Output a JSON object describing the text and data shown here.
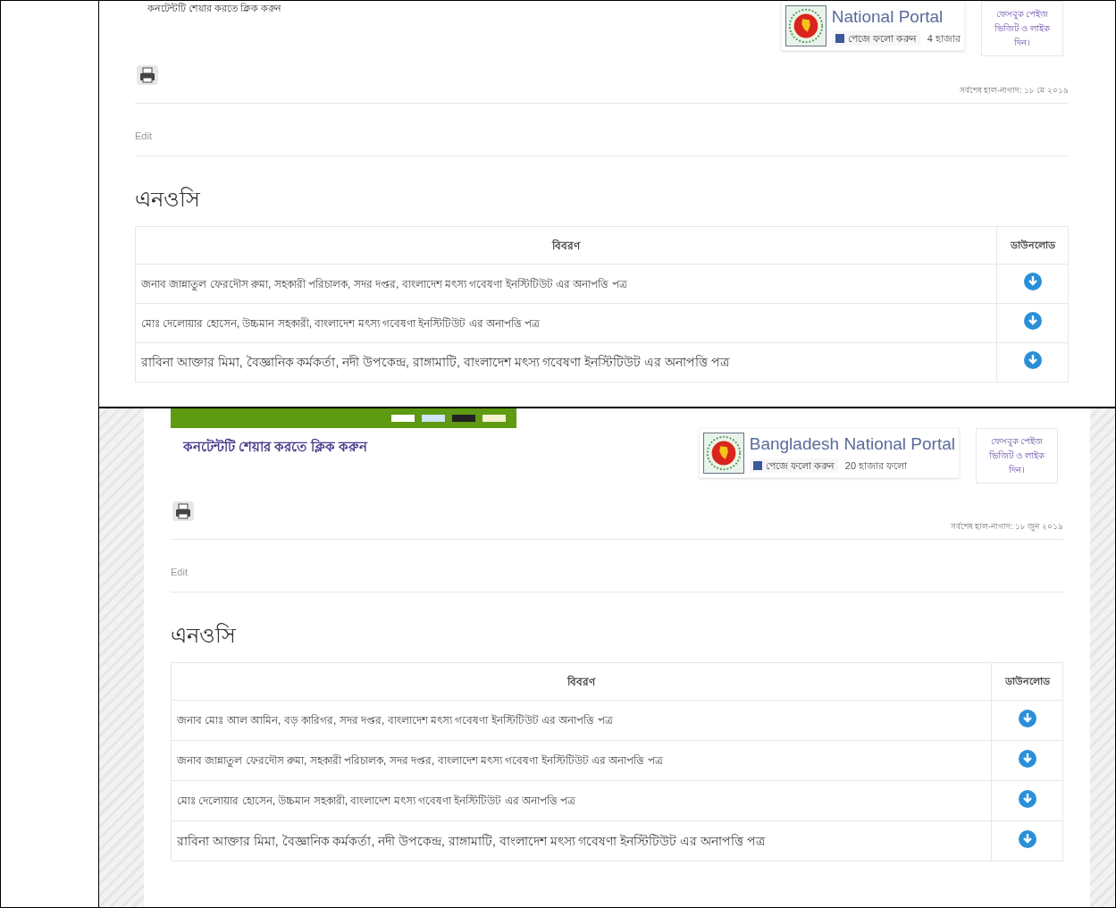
{
  "screenshots": [
    {
      "kind": "cropped",
      "share_link": "কনটেন্টটি শেয়ার করতে ক্লিক করুন",
      "portal": {
        "title": "National Portal",
        "follow": "পেজে ফলো করুন",
        "count": "4 হাজার"
      },
      "side_note": "ফেসবুক পেইজ ভিজিট ও লাইক দিন।",
      "updated": "সর্বশেষ হাল-নাগাদ: ১৮ মে ২০১৯",
      "edit": "Edit",
      "heading": "এনওসি",
      "table": {
        "columns": [
          "বিবরণ",
          "ডাউনলোড"
        ],
        "rows": [
          "জনাব জান্নাতুল ফেরদৌস রুমা, সহকারী পরিচালক, সদর দপ্তর, বাংলাদেশ মৎস্য গবেষণা ইনস্টিটিউট এর অনাপত্তি পত্র",
          "মোঃ দেলোয়ার হোসেন, উচ্চমান সহকারী, বাংলাদেশ মৎস্য গবেষণা ইনস্টিটিউট এর অনাপত্তি পত্র",
          "রাবিনা আক্তার মিমা, বৈজ্ঞানিক কর্মকর্তা, নদী উপকেন্দ্র, রাঙ্গামাটি, বাংলাদেশ মৎস্য গবেষণা ইনস্টিটিউট এর অনাপত্তি পত্র"
        ]
      }
    },
    {
      "kind": "full",
      "share_link": "কনটেন্টটি শেয়ার করতে ক্লিক করুন",
      "portal": {
        "title": "Bangladesh National Portal",
        "follow": "পেজে ফলো করুন",
        "count": "20 হাজার ফলো"
      },
      "side_note": "ফেসবুক পেইজ ভিজিট ও লাইক দিন।",
      "updated": "সর্বশেষ হাল-নাগাদ: ১৮ জুন ২০১৯",
      "edit": "Edit",
      "heading": "এনওসি",
      "table": {
        "columns": [
          "বিবরণ",
          "ডাউনলোড"
        ],
        "rows": [
          "জনাব মোঃ আল আমিন, বড় কারিগর, সদর দপ্তর, বাংলাদেশ মৎস্য গবেষণা ইনস্টিটিউট এর অনাপত্তি পত্র",
          "জনাব জান্নাতুল ফেরদৌস রুমা, সহকারী পরিচালক, সদর দপ্তর, বাংলাদেশ মৎস্য গবেষণা ইনস্টিটিউট এর অনাপত্তি পত্র",
          "মোঃ দেলোয়ার হোসেন, উচ্চমান সহকারী, বাংলাদেশ মৎস্য গবেষণা ইনস্টিটিউট এর অনাপত্তি পত্র",
          "রাবিনা আক্তার মিমা, বৈজ্ঞানিক কর্মকর্তা, নদী উপকেন্দ্র, রাঙ্গামাটি, বাংলাদেশ মৎস্য গবেষণা ইনস্টিটিউট এর অনাপত্তি পত্র"
        ]
      }
    }
  ]
}
